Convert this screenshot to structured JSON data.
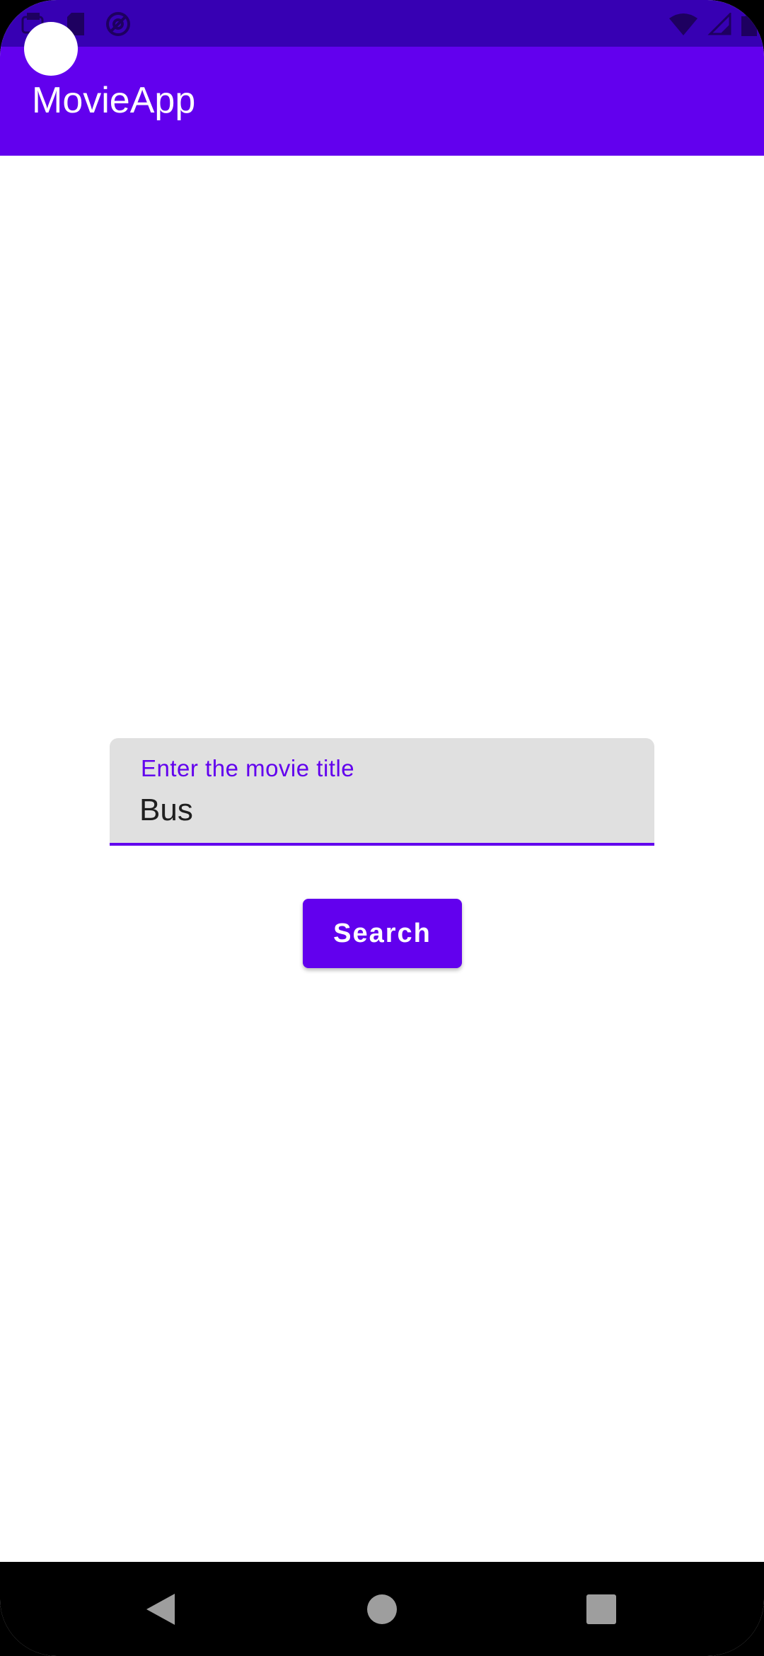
{
  "status_bar": {
    "left_icons": [
      "notification-icon",
      "sd-card-icon",
      "data-saver-icon"
    ],
    "right_icons": [
      "wifi-icon",
      "cell-signal-icon",
      "battery-icon"
    ],
    "bg_color": "#3700B3"
  },
  "app_bar": {
    "title": "MovieApp",
    "bg_color": "#6200EE"
  },
  "search_form": {
    "label": "Enter the movie title",
    "value": "Bus",
    "button_label": "Search",
    "accent_color": "#6200EE"
  },
  "nav_bar": {
    "icons": [
      "back-icon",
      "home-icon",
      "recents-icon"
    ]
  }
}
